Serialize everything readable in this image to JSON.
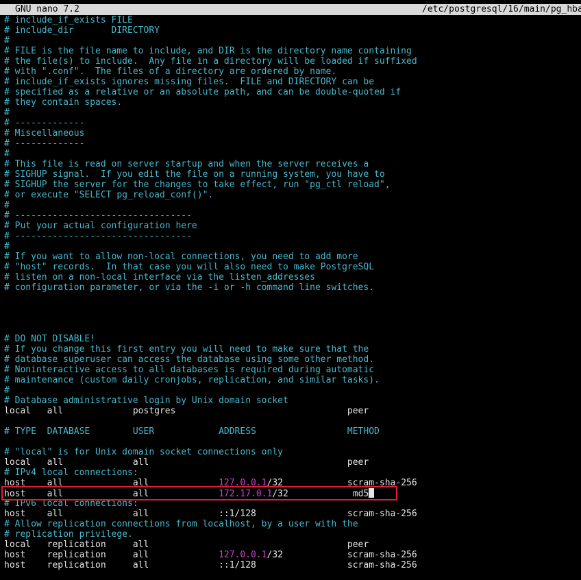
{
  "titlebar": {
    "app_name": "GNU nano 7.2",
    "file_path": "/etc/postgresql/16/main/pg_hba"
  },
  "colors": {
    "comment": "#48b8cc",
    "text": "#e6e6e6",
    "ip": "#c844c8",
    "highlight_box": "#e0202c",
    "titlebar_bg": "#d9d9d9"
  },
  "lines": {
    "l1": "# include_if_exists FILE",
    "l2": "# include_dir       DIRECTORY",
    "l3": "#",
    "l4": "# FILE is the file name to include, and DIR is the directory name containing",
    "l5": "# the file(s) to include.  Any file in a directory will be loaded if suffixed",
    "l6": "# with \".conf\".  The files of a directory are ordered by name.",
    "l7": "# include_if_exists ignores missing files.  FILE and DIRECTORY can be",
    "l8": "# specified as a relative or an absolute path, and can be double-quoted if",
    "l9": "# they contain spaces.",
    "l10": "#",
    "l11": "# -------------",
    "l12": "# Miscellaneous",
    "l13": "# -------------",
    "l14": "#",
    "l15": "# This file is read on server startup and when the server receives a",
    "l16": "# SIGHUP signal.  If you edit the file on a running system, you have to",
    "l17": "# SIGHUP the server for the changes to take effect, run \"pg_ctl reload\",",
    "l18": "# or execute \"SELECT pg_reload_conf()\".",
    "l19": "#",
    "l20": "# ---------------------------------",
    "l21": "# Put your actual configuration here",
    "l22": "# ---------------------------------",
    "l23": "#",
    "l24": "# If you want to allow non-local connections, you need to add more",
    "l25": "# \"host\" records.  In that case you will also need to make PostgreSQL",
    "l26": "# listen on a non-local interface via the listen_addresses",
    "l27": "# configuration parameter, or via the -i or -h command line switches.",
    "l32": "# DO NOT DISABLE!",
    "l33": "# If you change this first entry you will need to make sure that the",
    "l34": "# database superuser can access the database using some other method.",
    "l35": "# Noninteractive access to all databases is required during automatic",
    "l36": "# maintenance (custom daily cronjobs, replication, and similar tasks).",
    "l37": "#",
    "l38": "# Database administrative login by Unix domain socket",
    "l39": "local   all             postgres                                peer",
    "l41": "# TYPE  DATABASE        USER            ADDRESS                 METHOD",
    "l43": "# \"local\" is for Unix domain socket connections only",
    "l44": "local   all             all                                     peer",
    "l45": "# IPv4 local connections:",
    "l46a": "host    all             all             ",
    "l46ip": "127.0.0.1",
    "l46b": "/32            scram-sha-256",
    "l47a": "host    all             all             ",
    "l47ip": "172.17.0.1",
    "l47b": "/32            md5",
    "l48": "# IPv6 local connections:",
    "l49": "host    all             all             ::1/128                 scram-sha-256",
    "l50": "# Allow replication connections from localhost, by a user with the",
    "l51": "# replication privilege.",
    "l52": "local   replication     all                                     peer",
    "l53a": "host    replication     all             ",
    "l53ip": "127.0.0.1",
    "l53b": "/32            scram-sha-256",
    "l54": "host    replication     all             ::1/128                 scram-sha-256"
  }
}
